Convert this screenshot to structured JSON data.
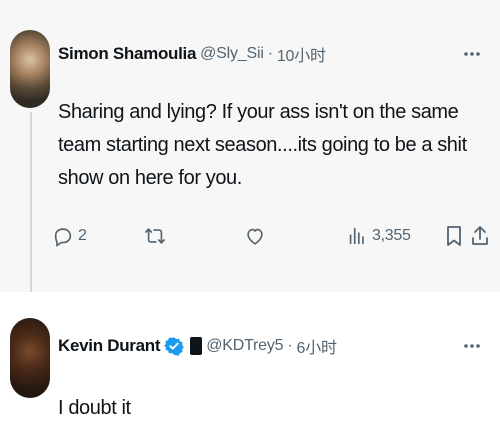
{
  "tweets": [
    {
      "display_name": "Simon Shamoulia",
      "handle": "@Sly_Sii",
      "separator": "·",
      "time": "10小时",
      "text": "Sharing and lying? If your ass isn't on the same team starting next season....its going to be a shit show on here for you.",
      "actions": {
        "reply_count": "2",
        "retweet_count": "",
        "like_count": "",
        "views_count": "3,355"
      },
      "icons": [
        "reply-icon",
        "retweet-icon",
        "like-icon",
        "views-icon",
        "bookmark-icon",
        "share-icon",
        "more-icon"
      ]
    },
    {
      "display_name": "Kevin Durant",
      "handle": "@KDTrey5",
      "separator": "·",
      "time": "6小时",
      "text": "I doubt it",
      "verified": true,
      "icons": [
        "verified-icon",
        "flag-icon",
        "more-icon"
      ]
    }
  ],
  "colors": {
    "verified": "#1d9bf0",
    "secondary_text": "#536471",
    "primary_text": "#0f1419"
  }
}
